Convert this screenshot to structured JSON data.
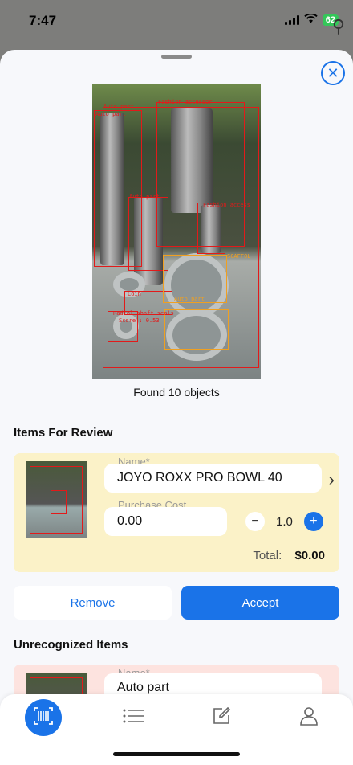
{
  "status_bar": {
    "time": "7:47",
    "battery": "62"
  },
  "detection": {
    "found_text": "Found 10 objects",
    "labels": [
      {
        "text": "Auto part",
        "color": "red"
      },
      {
        "text": "Auto part",
        "color": "red"
      },
      {
        "text": "Fashion accessor",
        "color": "red"
      },
      {
        "text": "Auto part",
        "color": "red"
      },
      {
        "text": "Fashion access",
        "color": "red"
      },
      {
        "text": "Coin",
        "color": "red"
      },
      {
        "text": "Radial shaft seals",
        "color": "red"
      },
      {
        "text": "Score : 0.53",
        "color": "red"
      },
      {
        "text": "Auto part",
        "color": "orange"
      },
      {
        "text": "SCAFFOL",
        "color": "orange"
      }
    ]
  },
  "review": {
    "section_title": "Items For Review",
    "name_label": "Name*",
    "name_value": "JOYO ROXX PRO BOWL 40",
    "cost_label": "Purchase Cost",
    "cost_value": "0.00",
    "quantity": "1.0",
    "total_label": "Total:",
    "total_value": "$0.00"
  },
  "actions": {
    "remove": "Remove",
    "accept": "Accept"
  },
  "unrecognized": {
    "section_title": "Unrecognized Items",
    "name_label": "Name*",
    "name_value": "Auto part"
  },
  "colors": {
    "accent": "#1a73e8",
    "review_bg": "#fbf2c8",
    "unrec_bg": "#fde3df",
    "detect_red": "#e21a1a",
    "detect_orange": "#f0a020"
  }
}
